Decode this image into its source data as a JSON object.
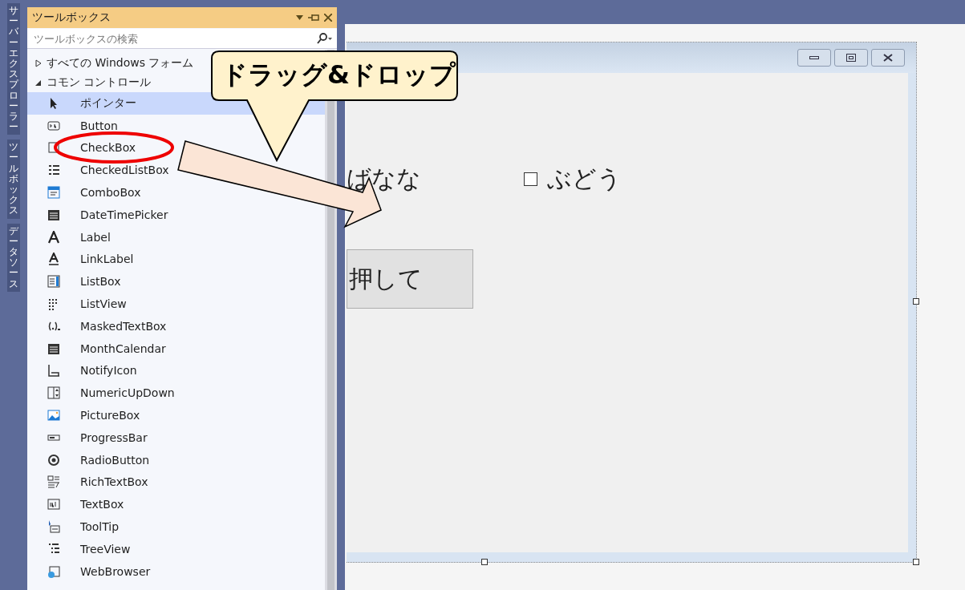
{
  "side_tabs": [
    {
      "label": "サーバーエクスプローラー"
    },
    {
      "label": "ツールボックス"
    },
    {
      "label": "データソース"
    }
  ],
  "toolbox": {
    "title": "ツールボックス",
    "search": {
      "placeholder": "ツールボックスの検索"
    },
    "groups": [
      {
        "label": "すべての Windows フォーム",
        "expanded": false
      },
      {
        "label": "コモン コントロール",
        "expanded": true,
        "items": [
          {
            "label": "ポインター",
            "selected": true
          },
          {
            "label": "Button",
            "selected": false
          },
          {
            "label": "CheckBox",
            "selected": false
          },
          {
            "label": "CheckedListBox",
            "selected": false
          },
          {
            "label": "ComboBox",
            "selected": false
          },
          {
            "label": "DateTimePicker",
            "selected": false
          },
          {
            "label": "Label",
            "selected": false
          },
          {
            "label": "LinkLabel",
            "selected": false
          },
          {
            "label": "ListBox",
            "selected": false
          },
          {
            "label": "ListView",
            "selected": false
          },
          {
            "label": "MaskedTextBox",
            "selected": false
          },
          {
            "label": "MonthCalendar",
            "selected": false
          },
          {
            "label": "NotifyIcon",
            "selected": false
          },
          {
            "label": "NumericUpDown",
            "selected": false
          },
          {
            "label": "PictureBox",
            "selected": false
          },
          {
            "label": "ProgressBar",
            "selected": false
          },
          {
            "label": "RadioButton",
            "selected": false
          },
          {
            "label": "RichTextBox",
            "selected": false
          },
          {
            "label": "TextBox",
            "selected": false
          },
          {
            "label": "ToolTip",
            "selected": false
          },
          {
            "label": "TreeView",
            "selected": false
          },
          {
            "label": "WebBrowser",
            "selected": false
          }
        ]
      }
    ]
  },
  "form": {
    "controls": [
      {
        "kind": "label",
        "label": "ばなな"
      },
      {
        "kind": "checkbox",
        "label": "ぶどう",
        "checked": false
      },
      {
        "kind": "button",
        "label": "押して"
      }
    ]
  },
  "callout": {
    "text": "ドラッグ&ドロップ"
  }
}
